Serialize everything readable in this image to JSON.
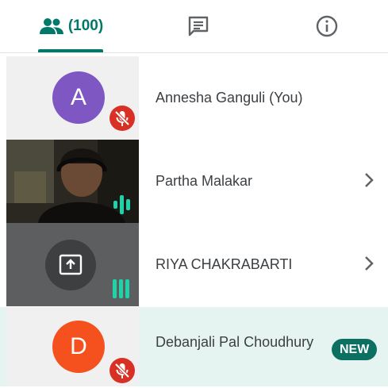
{
  "tabs": {
    "people_count": "(100)"
  },
  "participants": [
    {
      "initial": "A",
      "avatar_color": "#7e57c2",
      "name": "Annesha Ganguli (You)"
    },
    {
      "name": "Partha Malakar"
    },
    {
      "name": "RIYA CHAKRABARTI"
    },
    {
      "initial": "D",
      "avatar_color": "#f4511e",
      "name": "Debanjali Pal Choudhury",
      "badge": "NEW"
    }
  ],
  "colors": {
    "accent": "#00796b",
    "mute_badge": "#d93025",
    "speaking": "#1ed3a8",
    "highlight_row": "#e6f4f1"
  }
}
